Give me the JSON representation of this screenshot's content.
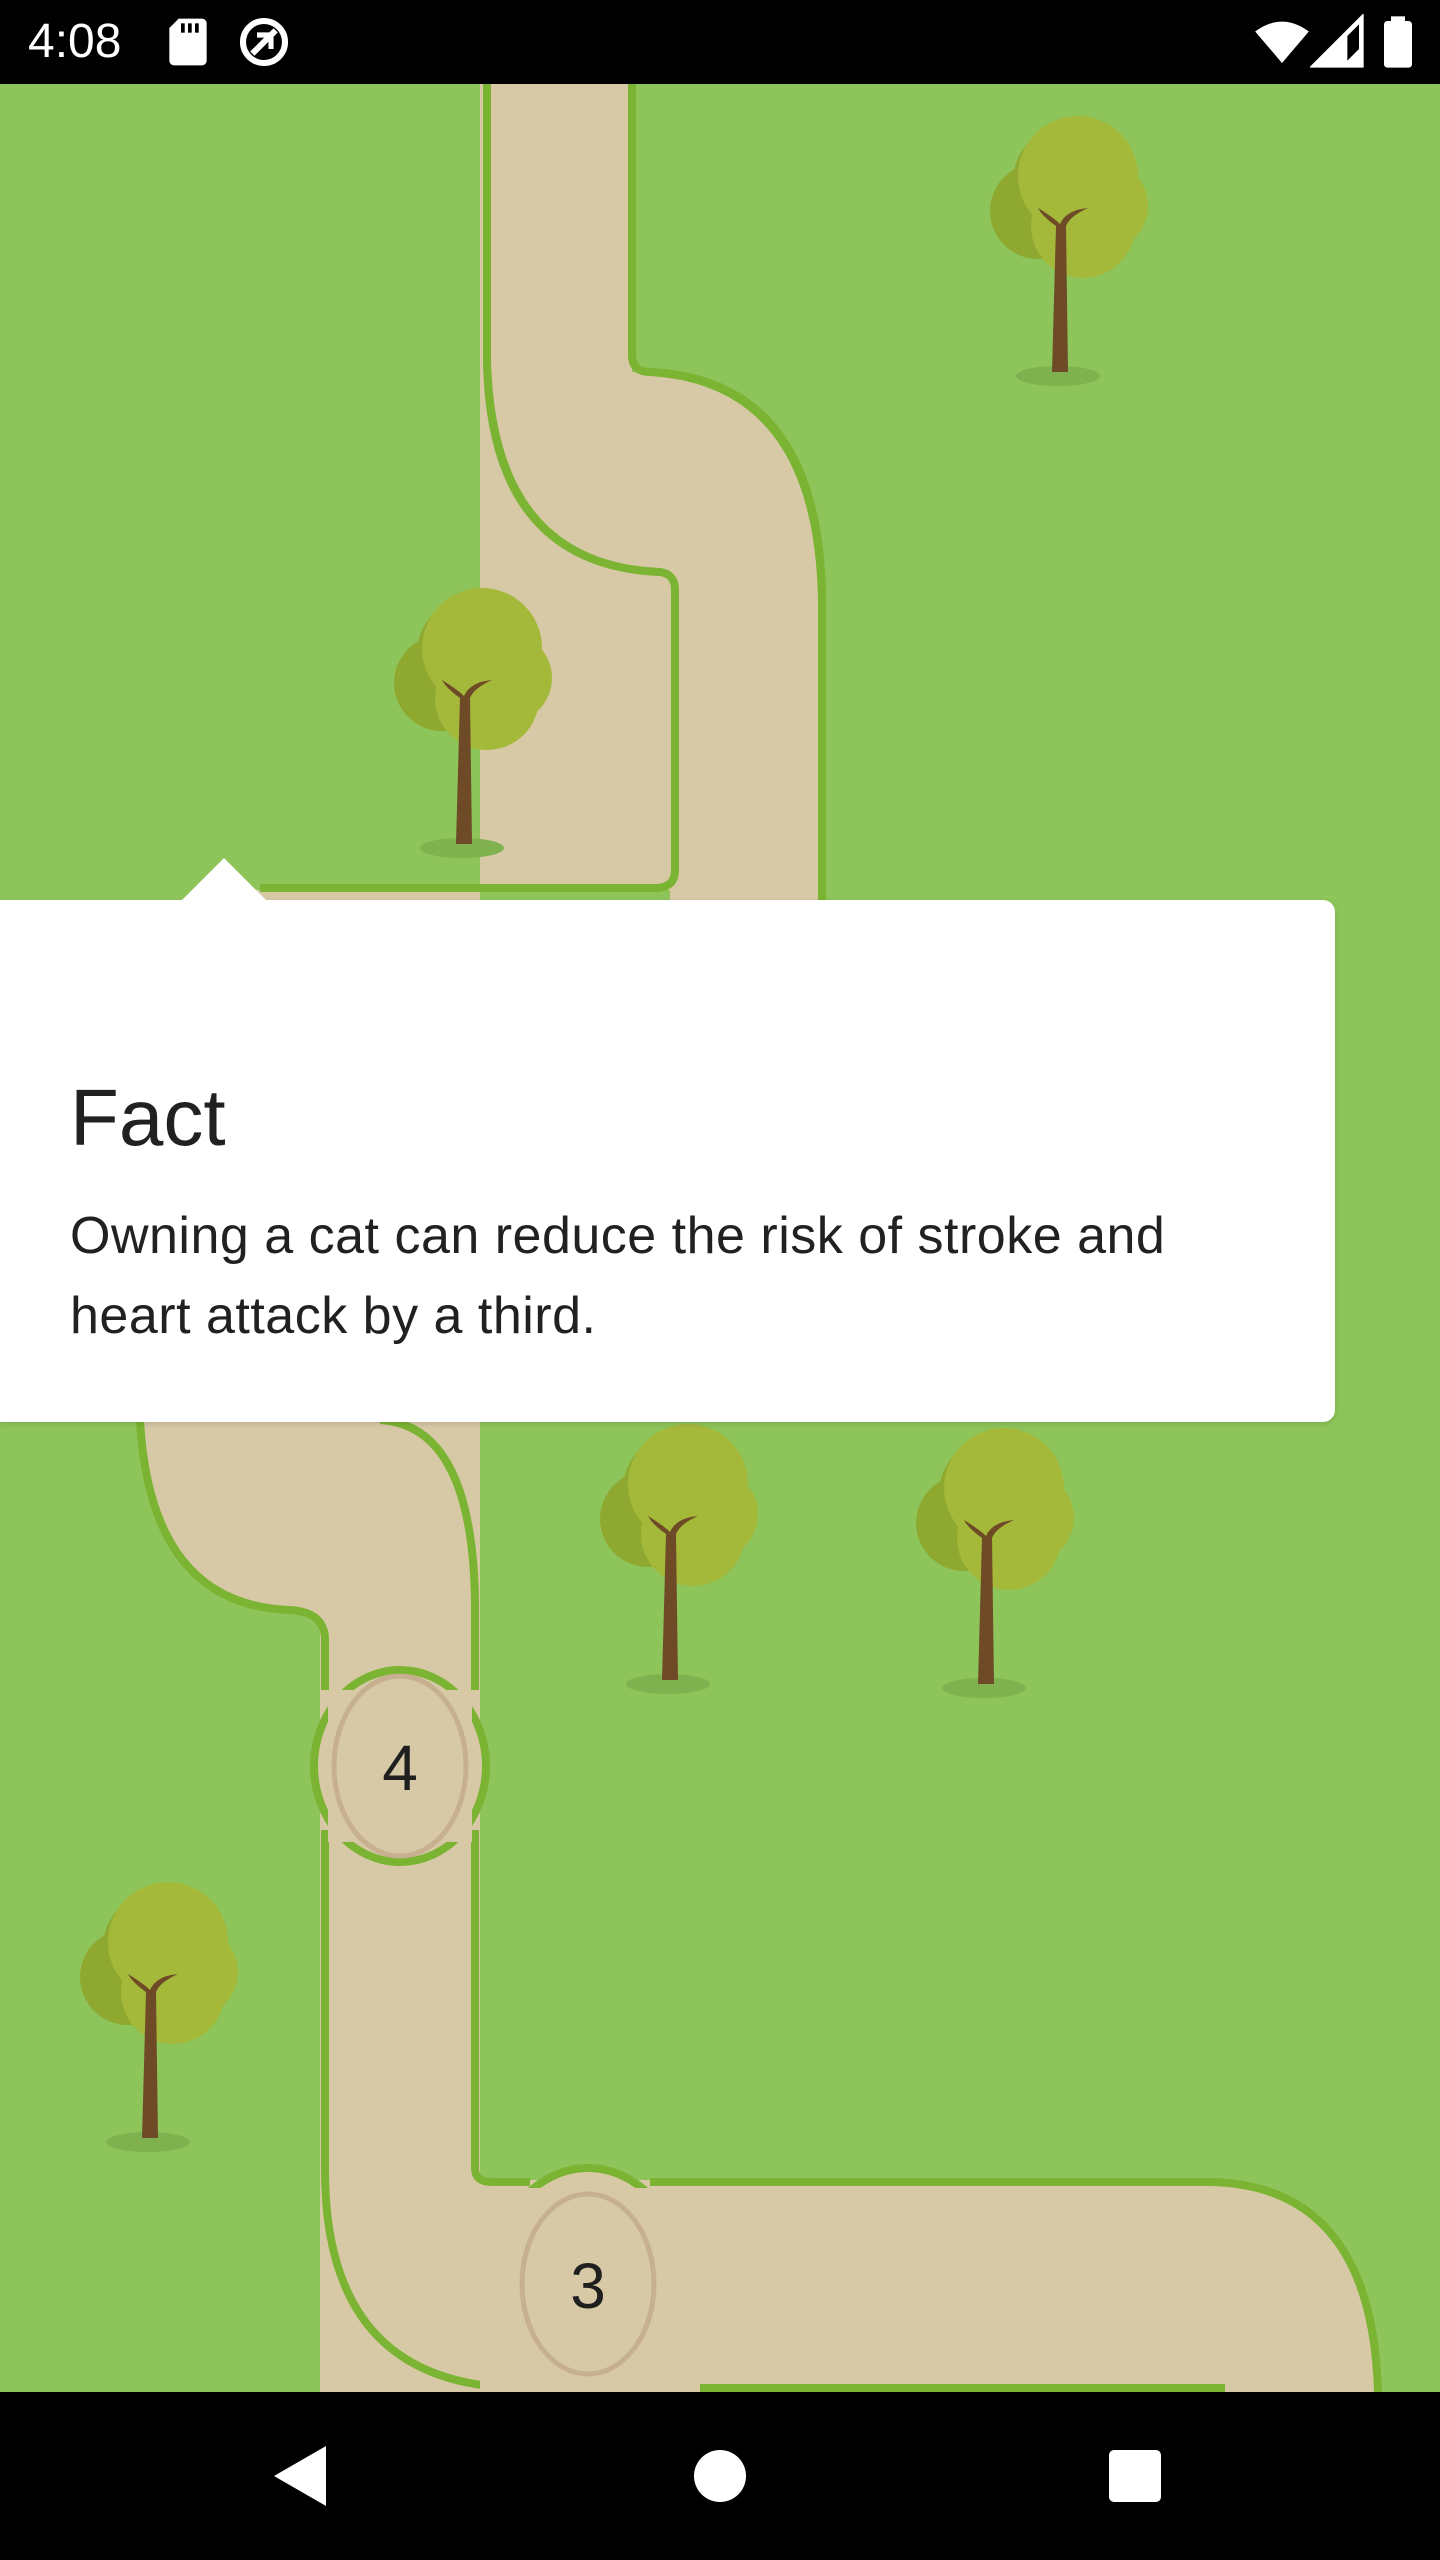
{
  "status_bar": {
    "time": "4:08",
    "left_icons": [
      "sd-card-icon",
      "data-saver-icon"
    ],
    "right_icons": [
      "wifi-icon",
      "cell-signal-icon",
      "battery-icon"
    ]
  },
  "map": {
    "levels": [
      {
        "label": "4"
      },
      {
        "label": "3"
      }
    ],
    "colors": {
      "grass": "#8dc55a",
      "path": "#d8c9a6",
      "path_border": "#7ab432",
      "tree_canopy": "#a4b83a",
      "tree_canopy_shade": "#8fa930",
      "tree_trunk": "#6e4a27"
    }
  },
  "fact": {
    "title": "Fact",
    "body": "Owning a cat can reduce the risk of stroke and heart attack by a third."
  },
  "nav_bar": {
    "buttons": [
      "back-icon",
      "home-icon",
      "recents-icon"
    ]
  }
}
